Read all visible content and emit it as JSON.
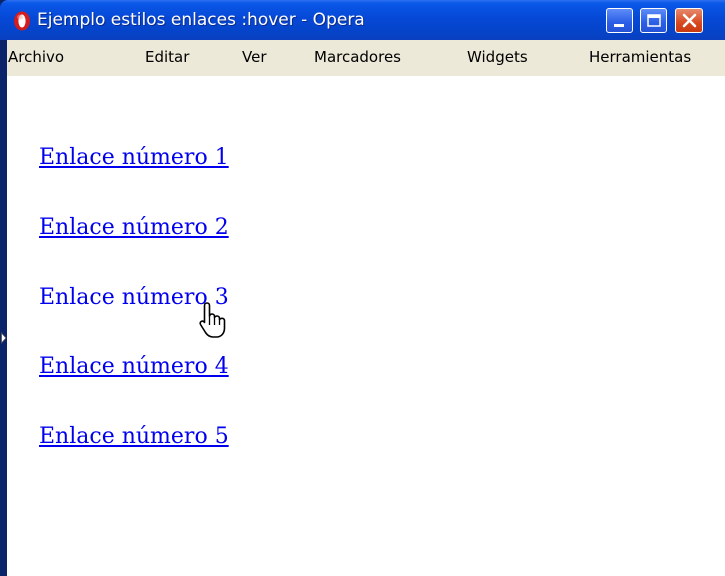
{
  "window": {
    "title": "Ejemplo estilos enlaces :hover - Opera"
  },
  "menu": {
    "items": [
      "Archivo",
      "Editar",
      "Ver",
      "Marcadores",
      "Widgets",
      "Herramientas"
    ]
  },
  "links": [
    {
      "label": "Enlace número 1",
      "state": "normal"
    },
    {
      "label": "Enlace número 2",
      "state": "normal"
    },
    {
      "label": "Enlace número 3",
      "state": "hover"
    },
    {
      "label": "Enlace número 4",
      "state": "normal"
    },
    {
      "label": "Enlace número 5",
      "state": "normal"
    }
  ],
  "icons": {
    "app": "opera-logo-icon",
    "minimize": "minimize-icon",
    "maximize": "maximize-icon",
    "close": "close-icon",
    "cursor": "hand-pointer-cursor-icon",
    "side_panel": "panel-toggle-arrow-icon"
  },
  "colors": {
    "title_bar": "#0648d6",
    "menu_bar": "#ece9d8",
    "link": "#0000ee",
    "close_button": "#d8491f"
  }
}
